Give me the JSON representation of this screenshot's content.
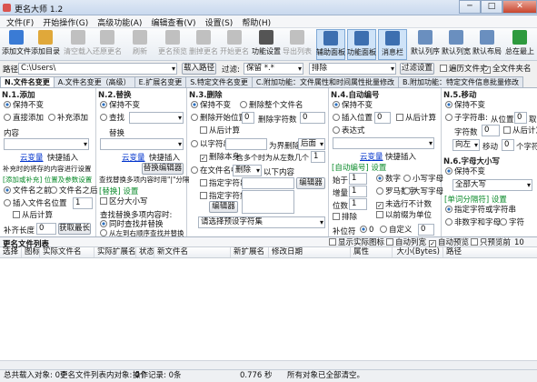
{
  "app": {
    "title": "更名大师 1.2"
  },
  "menu": [
    "文件(F)",
    "开始操作(G)",
    "高级功能(A)",
    "编辑查看(V)",
    "设置(S)",
    "帮助(H)"
  ],
  "toolbar": [
    {
      "label": "添加文件",
      "color": "#3a7bd5"
    },
    {
      "label": "添加目录",
      "color": "#e0a83a"
    },
    {
      "label": "清空载入",
      "color": "#c0c0c0"
    },
    {
      "label": "还原更名",
      "color": "#c0c0c0"
    },
    {
      "label": "刷新",
      "color": "#c0c0c0"
    },
    {
      "label": "更名预览",
      "color": "#c0c0c0"
    },
    {
      "label": "删掉更名",
      "color": "#c0c0c0"
    },
    {
      "label": "开始更名",
      "color": "#c0c0c0"
    },
    {
      "label": "功能设置",
      "color": "#555555"
    },
    {
      "label": "导出列表",
      "color": "#c0c0c0"
    },
    {
      "label": "辅助面板",
      "color": "#3d6fb0"
    },
    {
      "label": "功能面板",
      "color": "#3d6fb0"
    },
    {
      "label": "消息栏",
      "color": "#3d6fb0"
    },
    {
      "label": "默认列序",
      "color": "#6a8fbf"
    },
    {
      "label": "默认列宽",
      "color": "#6a8fbf"
    },
    {
      "label": "默认布局",
      "color": "#6a8fbf"
    },
    {
      "label": "总在最上",
      "color": "#2e9a3e"
    }
  ],
  "path": {
    "label": "路径",
    "value": "C:\\Users\\",
    "load_btn": "载入路径",
    "filter_label": "过滤:",
    "filter_value": "保留 *.*",
    "exclude_value": "排除",
    "filter_btn": "过滤设置",
    "traverse": "遍历文件夹",
    "fullname": "全文件夹名"
  },
  "tabs": [
    "N.文件名变更",
    "A.文件名变更（高级）",
    "E.扩展名变更",
    "S.特定文件名变更",
    "C.附加功能：文件属性和时间属性批量修改",
    "B.附加功能：特定文件信息批量修改"
  ],
  "n1": {
    "title": "N.1.添加",
    "keep": "保持不变",
    "direct": "直接添加",
    "pad": "补充添加",
    "content_label": "内容",
    "cloud": "云变量",
    "quick": "快捷插入",
    "insert_opts": "补充时的将存的内容进行设置",
    "green1": "[添加或补充] 位置及参数设置",
    "name_before": "文件名之前",
    "name_after": "文件名之后",
    "insert_pos": "插入文件名位置",
    "pos_val": "1",
    "from_right": "从后计算",
    "pad_len": "补齐长度",
    "pad_len_val": "0",
    "get_max": "获取最长"
  },
  "n2": {
    "title": "N.2.替换",
    "keep": "保持不变",
    "find": "查找",
    "replace": "替换",
    "cloud": "云变量",
    "quick": "快捷插入",
    "edit_replace": "替换编辑器",
    "note": "查找替换多项内容时用\"|\"分隔",
    "green": "[替换] 设置",
    "case": "区分大小写",
    "multi_note": "查找替换多项内容时:",
    "sync": "同时查找并替换",
    "l2r": "从左到右顺序查找并替换"
  },
  "n3": {
    "title": "N.3.删除",
    "keep": "保持不变",
    "del_all": "删除整个文件名",
    "del_pos": "删除开始位置",
    "del_pos_val": "0",
    "del_count": "删除字符数",
    "del_count_val": "0",
    "from_right": "从后计算",
    "with_char": "以字符串",
    "as_bound": "为界删除",
    "after": "后面",
    "del_self": "删除本身",
    "contain": "含多个时为从左数几个",
    "count_val": "1",
    "in_name": "在文件名中",
    "del_sel": "删除",
    "after_that": "以下内容",
    "spec_str": "指定字符串",
    "editor": "编辑器",
    "spec_set": "指定字符集",
    "editor2": "编辑器",
    "choose_del": "请选择预设字符集"
  },
  "n4": {
    "title": "N.4.自动编号",
    "keep": "保持不变",
    "insert_pos": "插入位置",
    "pos_val": "0",
    "from_right": "从后计算",
    "expr": "表达式",
    "cloud": "云变量",
    "quick": "快捷插入",
    "green": "[自动编号] 设置",
    "start": "始于",
    "start_val": "1",
    "number": "数字",
    "lower": "小写字母",
    "inc": "增量",
    "inc_val": "1",
    "roman": "罗马数字",
    "upper": "大写字母",
    "digits": "位数",
    "digits_val": "1",
    "reset": "未选行不计数",
    "folder_unit": "以前缀为单位",
    "exclude": "排除",
    "fill": "补位符",
    "zero": "0",
    "custom": "自定义",
    "custom_val": "0"
  },
  "n5": {
    "title": "N.5.移动",
    "keep": "保持不变",
    "substr": "子字符串:",
    "from_pos": "从位置",
    "pos_val": "0",
    "take": "取",
    "chars": "字符数",
    "chars_val": "0",
    "from_right": "从后计算",
    "dir": "向左",
    "move": "移动",
    "move_val": "0",
    "unit": "个字符"
  },
  "n6": {
    "title": "N.6.字母大小写",
    "keep": "保持不变",
    "all": "全部大写",
    "green": "[单词分隔符] 设置",
    "spec_char": "指定字符或字符串",
    "non_alpha": "非数字和字母",
    "char": "字符"
  },
  "list": {
    "title": "更名文件列表",
    "show_icon": "显示实际图标",
    "auto_list": "自动列宽",
    "auto_preview": "自动预览",
    "only_preview": "只预览前",
    "preview_n": "10"
  },
  "columns": [
    "选择",
    "图标",
    "实际文件名",
    "实际扩展名",
    "状态",
    "新文件名",
    "新扩展名",
    "修改日期",
    "属性",
    "大小(Bytes)",
    "路径"
  ],
  "status": [
    "总共载入对象: 0个",
    "更名文件列表内对象: 0个",
    "操作记录: 0条",
    "0.776 秒",
    "所有对象已全部清空。"
  ]
}
